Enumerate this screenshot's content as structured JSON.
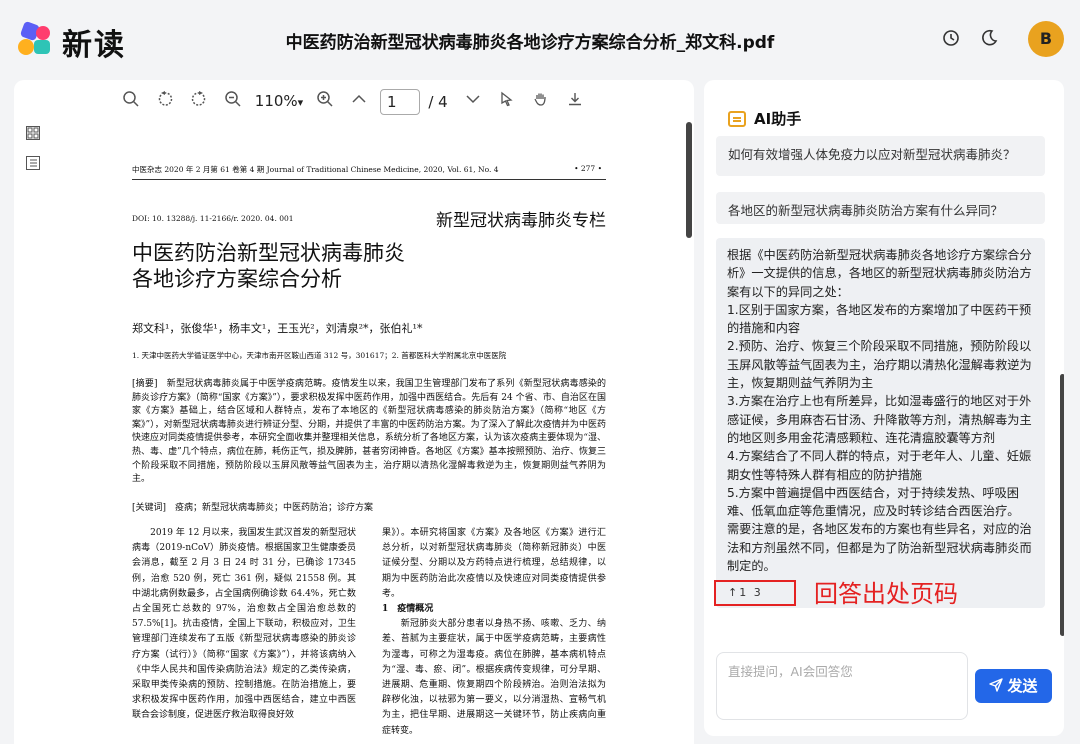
{
  "app": {
    "brand": "新读",
    "document_title": "中医药防治新型冠状病毒肺炎各地诊疗方案综合分析_郑文科.pdf",
    "avatar_letter": "B"
  },
  "viewer": {
    "zoom": "110%",
    "zoom_caret": "▾",
    "current_page": "1",
    "total_pages": "/ 4"
  },
  "pdf": {
    "header_left": "中医杂志 2020 年 2 月第 61 卷第 4 期 Journal of Traditional Chinese Medicine, 2020, Vol. 61, No. 4",
    "header_right": "• 277 •",
    "doi": "DOI: 10. 13288/j. 11-2166/r. 2020. 04. 001",
    "column_title": "新型冠状病毒肺炎专栏",
    "title_line1": "中医药防治新型冠状病毒肺炎",
    "title_line2": "各地诊疗方案综合分析",
    "authors": "郑文科¹，张俊华¹，杨丰文¹，王玉光²，刘清泉²*，张伯礼¹*",
    "affiliation": "1. 天津中医药大学循证医学中心，天津市南开区鞍山西道 312 号，301617；2. 首都医科大学附属北京中医医院",
    "abstract": "[摘要]　新型冠状病毒肺炎属于中医学疫病范畴。疫情发生以来，我国卫生管理部门发布了系列《新型冠状病毒感染的肺炎诊疗方案》（简称“国家《方案》”），要求积极发挥中医药作用，加强中西医结合。先后有 24 个省、市、自治区在国家《方案》基础上，结合区域和人群特点，发布了本地区的《新型冠状病毒感染的肺炎防治方案》（简称“地区《方案》”），对新型冠状病毒肺炎进行辨证分型、分期，并提供了丰富的中医药防治方案。为了深入了解此次疫情并为中医药快速应对同类疫情提供参考，本研究全面收集并整理相关信息，系统分析了各地区方案，认为该次疫病主要体现为“湿、热、毒、虚”几个特点，病位在肺，耗伤正气，损及脾肺，甚者穷闭神昏。各地区《方案》基本按照预防、治疗、恢复三个阶段采取不同措施，预防阶段以玉屏风散等益气固表为主，治疗期以清热化湿解毒救逆为主，恢复期则益气养阴为主。",
    "keywords": "[关键词]　疫病；新型冠状病毒肺炎；中医药防治；诊疗方案",
    "col1": "　　2019 年 12 月以来，我国发生武汉首发的新型冠状病毒（2019-nCoV）肺炎疫情。根据国家卫生健康委员会消息，截至 2 月 3 日 24 时 31 分，已确诊 17345 例，治愈 520 例，死亡 361 例，疑似 21558 例。其中湖北病例数最多，占全国病例确诊数 64.4%，死亡数占全国死亡总数的 97%，治愈数占全国治愈总数的 57.5%[1]。抗击疫情，全国上下联动，积极应对，卫生管理部门连续发布了五版《新型冠状病毒感染的肺炎诊疗方案（试行）》（简称“国家《方案》”），并将该病纳入《中华人民共和国传染病防治法》规定的乙类传染病，采取甲类传染病的预防、控制措施。在防治措施上，要求积极发挥中医药作用，加强中西医结合，建立中西医联合会诊制度，促进医疗救治取得良好效",
    "col2_intro": "果》）。本研究将国家《方案》及各地区《方案》进行汇总分析，以对新型冠状病毒肺炎（简称新冠肺炎）中医证候分型、分期以及方药特点进行梳理，总结规律，以期为中医药防治此次疫情以及快速应对同类疫情提供参考。",
    "col2_heading": "1　疫情概况",
    "col2_body": "　　新冠肺炎大部分患者以身热不扬、咳嗽、乏力、纳差、苔腻为主要症状，属于中医学疫病范畴，主要病性为湿毒，可称之为湿毒疫。病位在肺脾，基本病机特点为“湿、毒、瘀、闭”。根据疾病传变规律，可分早期、进展期、危重期、恢复期四个阶段辨治。治则治法拟为辟秽化浊，以祛邪为第一要义，以分消湿热、宣畅气机为主，把住早期、进展期这一关键环节，防止疾病向重症转变。"
  },
  "ai": {
    "title": "AI助手",
    "question1": "如何有效增强人体免疫力以应对新型冠状病毒肺炎？",
    "question2": "各地区的新型冠状病毒肺炎防治方案有什么异同？",
    "answer": "根据《中医药防治新型冠状病毒肺炎各地诊疗方案综合分析》一文提供的信息，各地区的新型冠状病毒肺炎防治方案有以下的异同之处：\n1.区别于国家方案，各地区发布的方案增加了中医药干预的措施和内容\n2.预防、治疗、恢复三个阶段采取不同措施，预防阶段以玉屏风散等益气固表为主，治疗期以清热化湿解毒救逆为主，恢复期则益气养阴为主\n3.方案在治疗上也有所差异，比如湿毒盛行的地区对于外感证候，多用麻杏石甘汤、升降散等方剂，清热解毒为主的地区则多用金花清感颗粒、连花清瘟胶囊等方剂\n4.方案结合了不同人群的特点，对于老年人、儿童、妊娠期女性等特殊人群有相应的防护措施\n5.方案中普遍提倡中西医结合，对于持续发热、呼吸困难、低氧血症等危重情况，应及时转诊结合西医治疗。\n需要注意的是，各地区发布的方案也有些异名，对应的治法和方剂虽然不同，但都是为了防治新型冠状病毒肺炎而制定的。",
    "citation": "↑1  3",
    "annotation": "回答出处页码",
    "input_placeholder": "直接提问，AI会回答您",
    "send_label": "发送"
  }
}
